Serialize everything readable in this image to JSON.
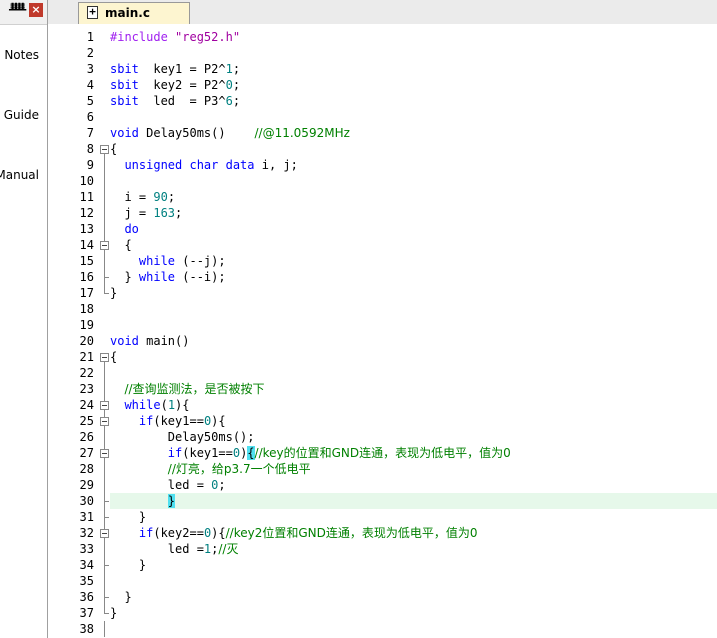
{
  "left_panel": {
    "books": [
      "Notes",
      "s Guide",
      "Manual"
    ]
  },
  "tab": {
    "label": "main.c"
  },
  "editor": {
    "lines": [
      {
        "n": "1",
        "parts": [
          [
            "pp",
            "#include "
          ],
          [
            "str",
            "\"reg52.h\""
          ]
        ]
      },
      {
        "n": "2",
        "parts": []
      },
      {
        "n": "3",
        "parts": [
          [
            "kw",
            "sbit"
          ],
          [
            "",
            "  key1 = P2^"
          ],
          [
            "num",
            "1"
          ],
          [
            "",
            ";"
          ]
        ]
      },
      {
        "n": "4",
        "parts": [
          [
            "kw",
            "sbit"
          ],
          [
            "",
            "  key2 = P2^"
          ],
          [
            "num",
            "0"
          ],
          [
            "",
            ";"
          ]
        ]
      },
      {
        "n": "5",
        "parts": [
          [
            "kw",
            "sbit"
          ],
          [
            "",
            "  led  = P3^"
          ],
          [
            "num",
            "6"
          ],
          [
            "",
            ";"
          ]
        ]
      },
      {
        "n": "6",
        "parts": []
      },
      {
        "n": "7",
        "parts": [
          [
            "kw",
            "void"
          ],
          [
            "",
            " Delay50ms()    "
          ],
          [
            "cm",
            "//@11.0592MHz"
          ]
        ]
      },
      {
        "n": "8",
        "parts": [
          [
            "",
            "{"
          ]
        ]
      },
      {
        "n": "9",
        "parts": [
          [
            "",
            "  "
          ],
          [
            "kw",
            "unsigned char data"
          ],
          [
            "",
            " i, j;"
          ]
        ]
      },
      {
        "n": "10",
        "parts": []
      },
      {
        "n": "11",
        "parts": [
          [
            "",
            "  i = "
          ],
          [
            "num",
            "90"
          ],
          [
            "",
            ";"
          ]
        ]
      },
      {
        "n": "12",
        "parts": [
          [
            "",
            "  j = "
          ],
          [
            "num",
            "163"
          ],
          [
            "",
            ";"
          ]
        ]
      },
      {
        "n": "13",
        "parts": [
          [
            "",
            "  "
          ],
          [
            "kw",
            "do"
          ]
        ]
      },
      {
        "n": "14",
        "parts": [
          [
            "",
            "  {"
          ]
        ]
      },
      {
        "n": "15",
        "parts": [
          [
            "",
            "    "
          ],
          [
            "kw",
            "while"
          ],
          [
            "",
            " (--j);"
          ]
        ]
      },
      {
        "n": "16",
        "parts": [
          [
            "",
            "  } "
          ],
          [
            "kw",
            "while"
          ],
          [
            "",
            " (--i);"
          ]
        ]
      },
      {
        "n": "17",
        "parts": [
          [
            "",
            "}"
          ]
        ]
      },
      {
        "n": "18",
        "parts": []
      },
      {
        "n": "19",
        "parts": []
      },
      {
        "n": "20",
        "parts": [
          [
            "kw",
            "void"
          ],
          [
            "",
            " main()"
          ]
        ]
      },
      {
        "n": "21",
        "parts": [
          [
            "",
            "{"
          ]
        ]
      },
      {
        "n": "22",
        "parts": []
      },
      {
        "n": "23",
        "parts": [
          [
            "",
            "  "
          ],
          [
            "cm",
            "//查询监测法，是否被按下"
          ]
        ]
      },
      {
        "n": "24",
        "parts": [
          [
            "",
            "  "
          ],
          [
            "kw",
            "while"
          ],
          [
            "",
            "("
          ],
          [
            "num",
            "1"
          ],
          [
            "",
            ")"
          ],
          [
            "",
            "{"
          ]
        ]
      },
      {
        "n": "25",
        "parts": [
          [
            "",
            "    "
          ],
          [
            "kw",
            "if"
          ],
          [
            "",
            "(key1=="
          ],
          [
            "num",
            "0"
          ],
          [
            "",
            ")"
          ],
          [
            "",
            "{"
          ]
        ]
      },
      {
        "n": "26",
        "parts": [
          [
            "",
            "        Delay50ms();"
          ]
        ]
      },
      {
        "n": "27",
        "parts": [
          [
            "",
            "        "
          ],
          [
            "kw",
            "if"
          ],
          [
            "",
            "(key1=="
          ],
          [
            "num",
            "0"
          ],
          [
            "",
            ")"
          ],
          [
            "brk",
            "{"
          ],
          [
            "cm",
            "//key的位置和GND连通，表现为低电平，值为0"
          ]
        ]
      },
      {
        "n": "28",
        "parts": [
          [
            "",
            "        "
          ],
          [
            "cm",
            "//灯亮，给p3.7一个低电平"
          ]
        ]
      },
      {
        "n": "29",
        "parts": [
          [
            "",
            "        led = "
          ],
          [
            "num",
            "0"
          ],
          [
            "",
            ";"
          ]
        ]
      },
      {
        "n": "30",
        "parts": [
          [
            "",
            "        "
          ],
          [
            "brk",
            "}"
          ]
        ]
      },
      {
        "n": "31",
        "parts": [
          [
            "",
            "    }"
          ]
        ]
      },
      {
        "n": "32",
        "parts": [
          [
            "",
            "    "
          ],
          [
            "kw",
            "if"
          ],
          [
            "",
            "(key2=="
          ],
          [
            "num",
            "0"
          ],
          [
            "",
            ")"
          ],
          [
            "",
            "{"
          ],
          [
            "cm",
            "//key2位置和GND连通，表现为低电平，值为0"
          ]
        ]
      },
      {
        "n": "33",
        "parts": [
          [
            "",
            "        led ="
          ],
          [
            "num",
            "1"
          ],
          [
            "",
            ";"
          ],
          [
            "cm",
            "//灭"
          ]
        ]
      },
      {
        "n": "34",
        "parts": [
          [
            "",
            "    }"
          ]
        ]
      },
      {
        "n": "35",
        "parts": []
      },
      {
        "n": "36",
        "parts": [
          [
            "",
            "  }"
          ]
        ]
      },
      {
        "n": "37",
        "parts": [
          [
            "",
            "}"
          ]
        ]
      },
      {
        "n": "38",
        "parts": []
      }
    ],
    "highlight_line": "30"
  }
}
